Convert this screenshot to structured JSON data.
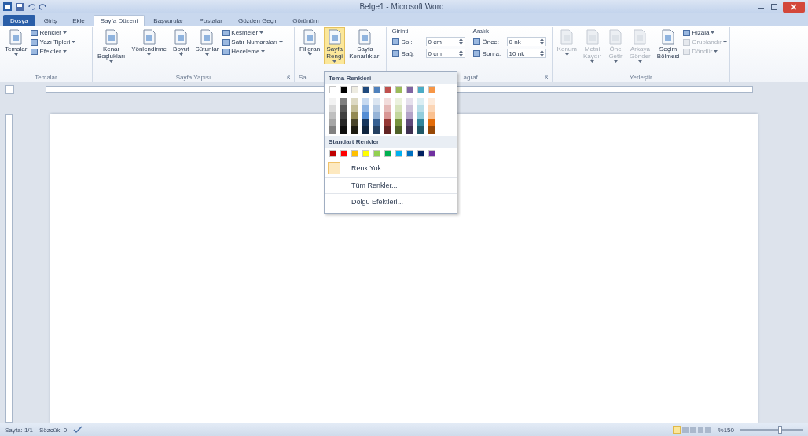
{
  "window": {
    "title": "Belge1 - Microsoft Word"
  },
  "tabs": [
    {
      "label": "Dosya",
      "kind": "file",
      "selected": false
    },
    {
      "label": "Giriş",
      "kind": "tab",
      "selected": false
    },
    {
      "label": "Ekle",
      "kind": "tab",
      "selected": false
    },
    {
      "label": "Sayfa Düzeni",
      "kind": "tab",
      "selected": true
    },
    {
      "label": "Başvurular",
      "kind": "tab",
      "selected": false
    },
    {
      "label": "Postalar",
      "kind": "tab",
      "selected": false
    },
    {
      "label": "Gözden Geçir",
      "kind": "tab",
      "selected": false
    },
    {
      "label": "Görünüm",
      "kind": "tab",
      "selected": false
    }
  ],
  "ribbon": {
    "groups": [
      {
        "label": "Temalar",
        "launcher": false,
        "columns": [
          {
            "kind": "large",
            "label": "Temalar",
            "dropdown": true,
            "selected": false,
            "disabled": false
          },
          {
            "kind": "stack",
            "items": [
              {
                "label": "Renkler",
                "dropdown": true,
                "disabled": false
              },
              {
                "label": "Yazı Tipleri",
                "dropdown": true,
                "disabled": false
              },
              {
                "label": "Efektler",
                "dropdown": true,
                "disabled": false
              }
            ]
          }
        ]
      },
      {
        "label": "Sayfa Yapısı",
        "launcher": true,
        "columns": [
          {
            "kind": "large",
            "label": "Kenar Boşlukları",
            "dropdown": true,
            "selected": false,
            "disabled": false
          },
          {
            "kind": "large",
            "label": "Yönlendirme",
            "dropdown": true,
            "selected": false,
            "disabled": false
          },
          {
            "kind": "large",
            "label": "Boyut",
            "dropdown": true,
            "selected": false,
            "disabled": false
          },
          {
            "kind": "large",
            "label": "Sütunlar",
            "dropdown": true,
            "selected": false,
            "disabled": false
          },
          {
            "kind": "stack",
            "items": [
              {
                "label": "Kesmeler",
                "dropdown": true,
                "disabled": false
              },
              {
                "label": "Satır Numaraları",
                "dropdown": true,
                "disabled": false
              },
              {
                "label": "Heceleme",
                "dropdown": true,
                "disabled": false
              }
            ]
          }
        ]
      },
      {
        "label": "Sa",
        "launcher": false,
        "columns": [
          {
            "kind": "large",
            "label": "Filigran",
            "dropdown": true,
            "selected": false,
            "disabled": false
          },
          {
            "kind": "large",
            "label": "Sayfa Rengi",
            "dropdown": true,
            "selected": true,
            "disabled": false
          },
          {
            "kind": "large",
            "label": "Sayfa Kenarlıkları",
            "dropdown": false,
            "selected": false,
            "disabled": false
          }
        ]
      },
      {
        "label": "agraf",
        "launcher": true,
        "columns": [
          {
            "kind": "spin",
            "title": "Girinti",
            "fields": [
              {
                "label": "Sol:",
                "value": "0 cm"
              },
              {
                "label": "Sağ:",
                "value": "0 cm"
              }
            ]
          },
          {
            "kind": "spin",
            "title": "Aralık",
            "fields": [
              {
                "label": "Önce:",
                "value": "0 nk"
              },
              {
                "label": "Sonra:",
                "value": "10 nk"
              }
            ]
          }
        ]
      },
      {
        "label": "Yerleştir",
        "launcher": false,
        "columns": [
          {
            "kind": "large",
            "label": "Konum",
            "dropdown": true,
            "selected": false,
            "disabled": true
          },
          {
            "kind": "large",
            "label": "Metni Kaydır",
            "dropdown": true,
            "selected": false,
            "disabled": true
          },
          {
            "kind": "large",
            "label": "Öne Getir",
            "dropdown": true,
            "selected": false,
            "disabled": true
          },
          {
            "kind": "large",
            "label": "Arkaya Gönder",
            "dropdown": true,
            "selected": false,
            "disabled": true
          },
          {
            "kind": "large",
            "label": "Seçim Bölmesi",
            "dropdown": false,
            "selected": false,
            "disabled": false
          },
          {
            "kind": "stack",
            "items": [
              {
                "label": "Hizala",
                "dropdown": true,
                "disabled": false
              },
              {
                "label": "Gruplandır",
                "dropdown": true,
                "disabled": true
              },
              {
                "label": "Döndür",
                "dropdown": true,
                "disabled": true
              }
            ]
          }
        ]
      }
    ]
  },
  "dropdown": {
    "theme_title": "Tema Renkleri",
    "theme_colors": [
      {
        "color": "#ffffff",
        "shades": [
          {
            "color": "#f2f2f2"
          },
          {
            "color": "#d9d9d9"
          },
          {
            "color": "#bfbfbf"
          },
          {
            "color": "#a6a6a6"
          },
          {
            "color": "#808080"
          }
        ]
      },
      {
        "color": "#000000",
        "shades": [
          {
            "color": "#7f7f7f"
          },
          {
            "color": "#595959"
          },
          {
            "color": "#404040"
          },
          {
            "color": "#262626"
          },
          {
            "color": "#0d0d0d"
          }
        ]
      },
      {
        "color": "#eeece1",
        "shades": [
          {
            "color": "#ddd9c3"
          },
          {
            "color": "#c4bd97"
          },
          {
            "color": "#938953"
          },
          {
            "color": "#494429"
          },
          {
            "color": "#1d1b10"
          }
        ]
      },
      {
        "color": "#1f497d",
        "shades": [
          {
            "color": "#c6d9f0"
          },
          {
            "color": "#8db3e2"
          },
          {
            "color": "#548dd4"
          },
          {
            "color": "#17365d"
          },
          {
            "color": "#0f243e"
          }
        ]
      },
      {
        "color": "#4f81bd",
        "shades": [
          {
            "color": "#dbe5f1"
          },
          {
            "color": "#b8cce4"
          },
          {
            "color": "#95b3d7"
          },
          {
            "color": "#366092"
          },
          {
            "color": "#244061"
          }
        ]
      },
      {
        "color": "#c0504d",
        "shades": [
          {
            "color": "#f2dcdb"
          },
          {
            "color": "#e5b9b7"
          },
          {
            "color": "#d99694"
          },
          {
            "color": "#953734"
          },
          {
            "color": "#632423"
          }
        ]
      },
      {
        "color": "#9bbb59",
        "shades": [
          {
            "color": "#ebf1dd"
          },
          {
            "color": "#d7e3bc"
          },
          {
            "color": "#c3d69b"
          },
          {
            "color": "#76923c"
          },
          {
            "color": "#4f6128"
          }
        ]
      },
      {
        "color": "#8064a2",
        "shades": [
          {
            "color": "#e5e0ec"
          },
          {
            "color": "#ccc1d9"
          },
          {
            "color": "#b2a2c7"
          },
          {
            "color": "#5f497a"
          },
          {
            "color": "#3f3151"
          }
        ]
      },
      {
        "color": "#4bacc6",
        "shades": [
          {
            "color": "#dbeef3"
          },
          {
            "color": "#b7dde8"
          },
          {
            "color": "#92cddc"
          },
          {
            "color": "#31859b"
          },
          {
            "color": "#205867"
          }
        ]
      },
      {
        "color": "#f79646",
        "shades": [
          {
            "color": "#fdeada"
          },
          {
            "color": "#fbd5b5"
          },
          {
            "color": "#fac08f"
          },
          {
            "color": "#e36c09"
          },
          {
            "color": "#974806"
          }
        ]
      }
    ],
    "standard_title": "Standart Renkler",
    "standard_colors": [
      {
        "color": "#c00000"
      },
      {
        "color": "#ff0000"
      },
      {
        "color": "#ffc000"
      },
      {
        "color": "#ffff00"
      },
      {
        "color": "#92d050"
      },
      {
        "color": "#00b050"
      },
      {
        "color": "#00b0f0"
      },
      {
        "color": "#0070c0"
      },
      {
        "color": "#002060"
      },
      {
        "color": "#7030a0"
      }
    ],
    "no_color": "Renk Yok",
    "items": [
      "Tüm Renkler...",
      "Dolgu Efektleri..."
    ]
  },
  "status_bar": {
    "page": "Sayfa: 1/1",
    "words": "Sözcük: 0",
    "zoom": "%150",
    "zoom_slider": {
      "level": 0.62
    }
  }
}
